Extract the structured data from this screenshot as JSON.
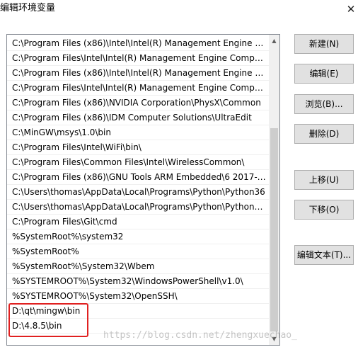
{
  "window": {
    "title": "编辑环境变量",
    "close_glyph": "✕"
  },
  "path_list": {
    "items": [
      "C:\\Program Files (x86)\\Intel\\Intel(R) Management Engine Co...",
      "C:\\Program Files\\Intel\\Intel(R) Management Engine Compon...",
      "C:\\Program Files (x86)\\Intel\\Intel(R) Management Engine Co...",
      "C:\\Program Files\\Intel\\Intel(R) Management Engine Compon...",
      "C:\\Program Files (x86)\\NVIDIA Corporation\\PhysX\\Common",
      "C:\\Program Files (x86)\\IDM Computer Solutions\\UltraEdit",
      "C:\\MinGW\\msys\\1.0\\bin",
      "C:\\Program Files\\Intel\\WiFi\\bin\\",
      "C:\\Program Files\\Common Files\\Intel\\WirelessCommon\\",
      "C:\\Program Files (x86)\\GNU Tools ARM Embedded\\6 2017-q...",
      "C:\\Users\\thomas\\AppData\\Local\\Programs\\Python\\Python36",
      "C:\\Users\\thomas\\AppData\\Local\\Programs\\Python\\Python36...",
      "C:\\Program Files\\Git\\cmd",
      "%SystemRoot%\\system32",
      "%SystemRoot%",
      "%SystemRoot%\\System32\\Wbem",
      "%SYSTEMROOT%\\System32\\WindowsPowerShell\\v1.0\\",
      "%SYSTEMROOT%\\System32\\OpenSSH\\",
      "D:\\qt\\mingw\\bin",
      "D:\\4.8.5\\bin"
    ],
    "scroll_up_glyph": "▲",
    "scroll_down_glyph": "▼"
  },
  "buttons": {
    "new": "新建(N)",
    "edit": "编辑(E)",
    "browse": "浏览(B)...",
    "delete": "删除(D)",
    "move_up": "上移(U)",
    "move_down": "下移(O)",
    "edit_text": "编辑文本(T)..."
  },
  "watermark": "https://blog.csdn.net/zhengxuechao_",
  "colors": {
    "highlight": "#e02020",
    "button_face": "#e1e1e1",
    "list_border": "#828790"
  }
}
